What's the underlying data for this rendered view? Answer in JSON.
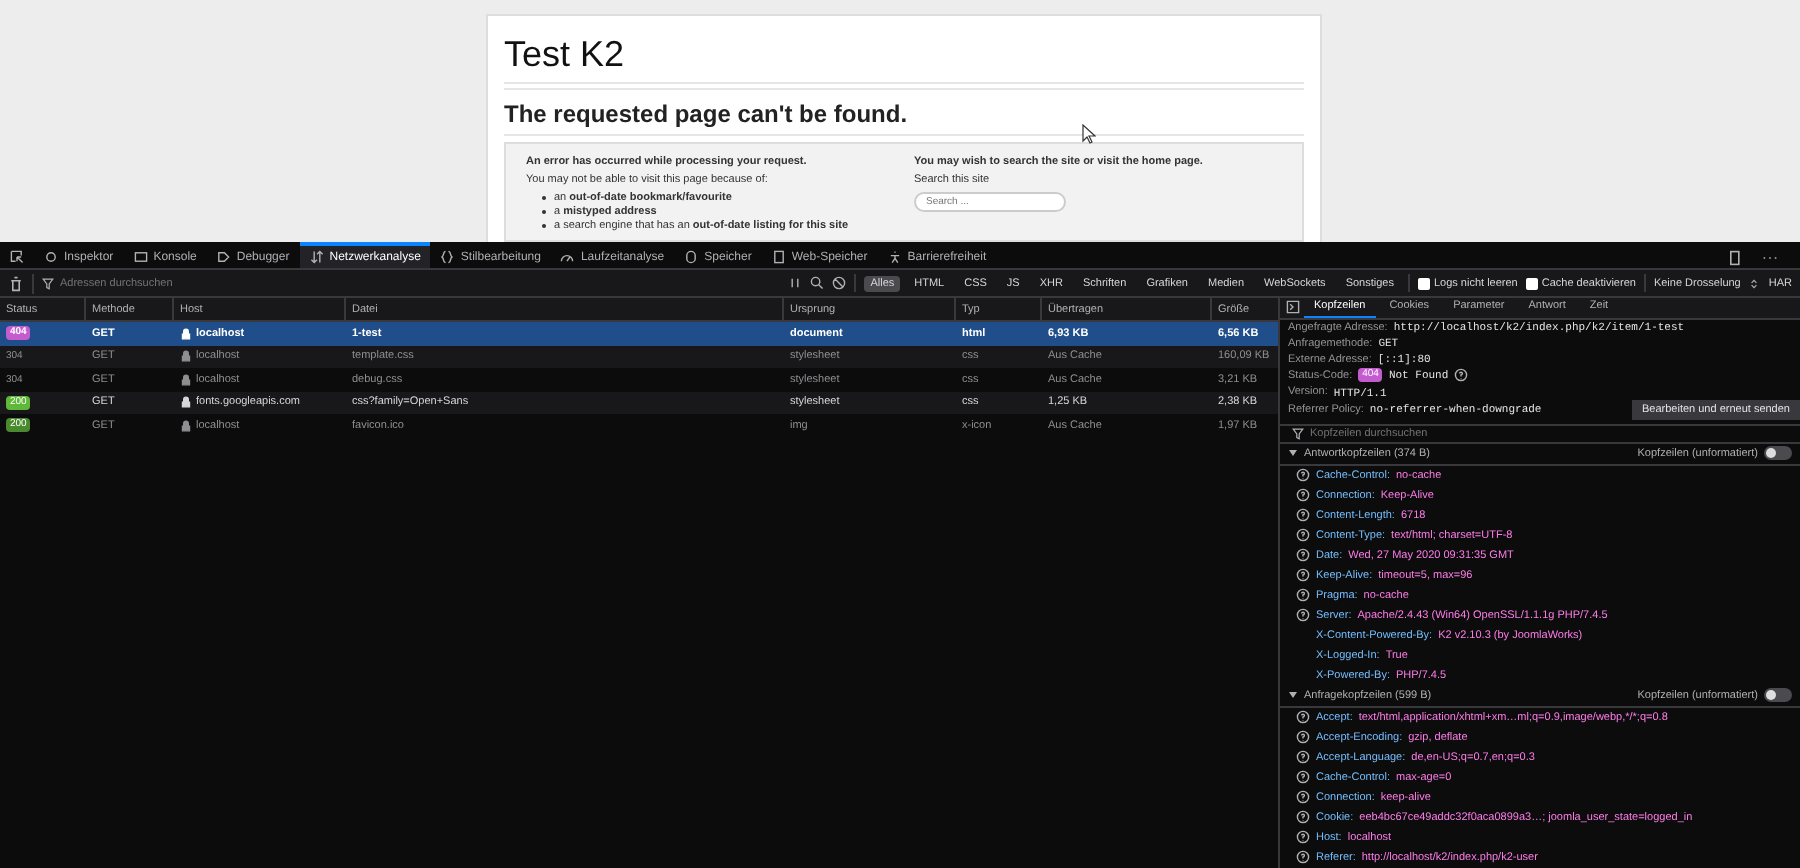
{
  "page": {
    "site_title": "Test K2",
    "heading": "The requested page can't be found.",
    "left": {
      "intro": "An error has occurred while processing your request.",
      "reason": "You may not be able to visit this page because of:",
      "bullets": [
        "an **out-of-date bookmark/favourite**",
        "a **mistyped address**",
        "a search engine that has an **out-of-date listing for this site**"
      ]
    },
    "right": {
      "intro": "You may wish to search the site or visit the home page.",
      "search_label": "Search this site",
      "search_placeholder": "Search ..."
    }
  },
  "toolbar": {
    "tabs": [
      {
        "label": "Inspektor",
        "selected": false
      },
      {
        "label": "Konsole",
        "selected": false
      },
      {
        "label": "Debugger",
        "selected": false
      },
      {
        "label": "Netzwerkanalyse",
        "selected": true
      },
      {
        "label": "Stilbearbeitung",
        "selected": false
      },
      {
        "label": "Laufzeitanalyse",
        "selected": false
      },
      {
        "label": "Speicher",
        "selected": false
      },
      {
        "label": "Web-Speicher",
        "selected": false
      },
      {
        "label": "Barrierefreiheit",
        "selected": false
      }
    ]
  },
  "filter_bar": {
    "placeholder": "Adressen durchsuchen",
    "types": [
      {
        "label": "Alles",
        "selected": true
      },
      {
        "label": "HTML",
        "selected": false
      },
      {
        "label": "CSS",
        "selected": false
      },
      {
        "label": "JS",
        "selected": false
      },
      {
        "label": "XHR",
        "selected": false
      },
      {
        "label": "Schriften",
        "selected": false
      },
      {
        "label": "Grafiken",
        "selected": false
      },
      {
        "label": "Medien",
        "selected": false
      },
      {
        "label": "WebSockets",
        "selected": false
      },
      {
        "label": "Sonstiges",
        "selected": false
      }
    ],
    "checkboxes": [
      {
        "label": "Logs nicht leeren",
        "checked": false
      },
      {
        "label": "Cache deaktivieren",
        "checked": false
      }
    ],
    "throttle": "Keine Drosselung",
    "har": "HAR"
  },
  "table": {
    "columns": [
      "Status",
      "Methode",
      "Host",
      "Datei",
      "Ursprung",
      "Typ",
      "Übertragen",
      "Größe"
    ],
    "rows": [
      {
        "status": "404",
        "kind": "badge",
        "color": "#c45ccf",
        "method": "GET",
        "host": "localhost",
        "file": "1-test",
        "origin": "document",
        "type": "html",
        "transferred": "6,93 KB",
        "size": "6,56 KB",
        "selected": true,
        "cached": false
      },
      {
        "status": "304",
        "kind": "plain",
        "method": "GET",
        "host": "localhost",
        "file": "template.css",
        "origin": "stylesheet",
        "type": "css",
        "transferred": "Aus Cache",
        "size": "160,09 KB",
        "selected": false,
        "cached": true
      },
      {
        "status": "304",
        "kind": "plain",
        "method": "GET",
        "host": "localhost",
        "file": "debug.css",
        "origin": "stylesheet",
        "type": "css",
        "transferred": "Aus Cache",
        "size": "3,21 KB",
        "selected": false,
        "cached": true
      },
      {
        "status": "200",
        "kind": "badge",
        "color": "#5fb83a",
        "method": "GET",
        "host": "fonts.googleapis.com",
        "file": "css?family=Open+Sans",
        "origin": "stylesheet",
        "type": "css",
        "transferred": "1,25 KB",
        "size": "2,38 KB",
        "selected": false,
        "cached": false
      },
      {
        "status": "200",
        "kind": "badge",
        "color": "#4a8a2e",
        "method": "GET",
        "host": "localhost",
        "file": "favicon.ico",
        "origin": "img",
        "type": "x-icon",
        "transferred": "Aus Cache",
        "size": "1,97 KB",
        "selected": false,
        "cached": true
      }
    ]
  },
  "details": {
    "tabs": [
      {
        "label": "Kopfzeilen",
        "selected": true
      },
      {
        "label": "Cookies",
        "selected": false
      },
      {
        "label": "Parameter",
        "selected": false
      },
      {
        "label": "Antwort",
        "selected": false
      },
      {
        "label": "Zeit",
        "selected": false
      }
    ],
    "summary": [
      {
        "kind": "text",
        "label": "Angefragte Adresse:",
        "value": "http://localhost/k2/index.php/k2/item/1-test"
      },
      {
        "kind": "text",
        "label": "Anfragemethode:",
        "value": "GET"
      },
      {
        "kind": "text",
        "label": "Externe Adresse:",
        "value": "[::1]:80"
      },
      {
        "kind": "status",
        "label": "Status-Code:",
        "code": "404",
        "color": "#c45ccf",
        "value": "Not Found"
      },
      {
        "kind": "text",
        "label": "Version:",
        "value": "HTTP/1.1"
      },
      {
        "kind": "text",
        "label": "Referrer Policy:",
        "value": "no-referrer-when-downgrade"
      }
    ],
    "resend_button": "Bearbeiten und erneut senden",
    "filter_placeholder": "Kopfzeilen durchsuchen",
    "sections": [
      {
        "title": "Antwortkopfzeilen (374 B)",
        "raw_label": "Kopfzeilen (unformatiert)",
        "raw": false,
        "expanded": true,
        "headers": [
          {
            "name": "Cache-Control:",
            "value": "no-cache",
            "help": true
          },
          {
            "name": "Connection:",
            "value": "Keep-Alive",
            "help": true
          },
          {
            "name": "Content-Length:",
            "value": "6718",
            "help": true
          },
          {
            "name": "Content-Type:",
            "value": "text/html; charset=UTF-8",
            "help": true
          },
          {
            "name": "Date:",
            "value": "Wed, 27 May 2020 09:31:35 GMT",
            "help": true
          },
          {
            "name": "Keep-Alive:",
            "value": "timeout=5, max=96",
            "help": true
          },
          {
            "name": "Pragma:",
            "value": "no-cache",
            "help": true
          },
          {
            "name": "Server:",
            "value": "Apache/2.4.43 (Win64) OpenSSL/1.1.1g PHP/7.4.5",
            "help": true
          },
          {
            "name": "X-Content-Powered-By:",
            "value": "K2 v2.10.3 (by JoomlaWorks)",
            "help": false
          },
          {
            "name": "X-Logged-In:",
            "value": "True",
            "help": false
          },
          {
            "name": "X-Powered-By:",
            "value": "PHP/7.4.5",
            "help": false
          }
        ]
      },
      {
        "title": "Anfragekopfzeilen (599 B)",
        "raw_label": "Kopfzeilen (unformatiert)",
        "raw": false,
        "expanded": true,
        "headers": [
          {
            "name": "Accept:",
            "value": "text/html,application/xhtml+xm…ml;q=0.9,image/webp,*/*;q=0.8",
            "help": true
          },
          {
            "name": "Accept-Encoding:",
            "value": "gzip, deflate",
            "help": true
          },
          {
            "name": "Accept-Language:",
            "value": "de,en-US;q=0.7,en;q=0.3",
            "help": true
          },
          {
            "name": "Cache-Control:",
            "value": "max-age=0",
            "help": true
          },
          {
            "name": "Connection:",
            "value": "keep-alive",
            "help": true
          },
          {
            "name": "Cookie:",
            "value": "eeb4bc67ce49addc32f0aca0899a3…; joomla_user_state=logged_in",
            "help": true
          },
          {
            "name": "Host:",
            "value": "localhost",
            "help": true
          },
          {
            "name": "Referer:",
            "value": "http://localhost/k2/index.php/k2-user",
            "help": true
          }
        ]
      }
    ]
  }
}
